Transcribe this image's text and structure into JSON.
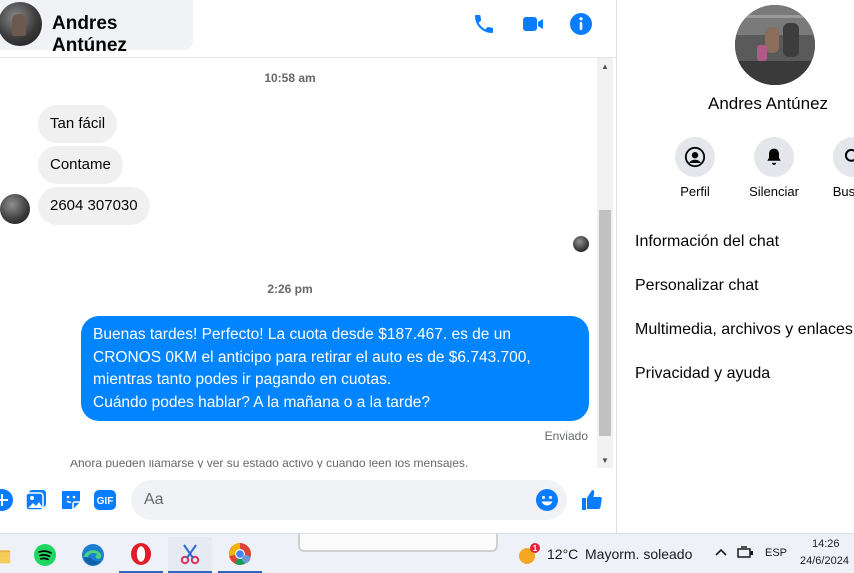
{
  "header": {
    "contact_name": "Andres Antúnez",
    "icons": [
      "phone-icon",
      "video-call-icon",
      "info-icon"
    ]
  },
  "messages": {
    "timestamp_1": "10:58 am",
    "incoming": [
      "Tan fácil",
      "Contame",
      "2604 307030"
    ],
    "timestamp_2": "2:26 pm",
    "outgoing_lines": [
      "Buenas tardes! Perfecto! La cuota desde $187.467. es de un",
      "CRONOS 0KM el anticipo para retirar el auto es de $6.743.700,",
      "mientras tanto podes ir pagando en cuotas.",
      "Cuándo podes hablar? A la mañana o a la tarde?"
    ],
    "sent_status": "Enviado",
    "notice": "Ahora pueden llamarse y ver su estado activo y cuándo leen los mensajes."
  },
  "composer": {
    "placeholder": "Aa",
    "icons": [
      "plus-icon",
      "photo-icon",
      "sticker-icon",
      "gif-icon",
      "emoji-icon",
      "like-icon"
    ],
    "gif_label": "GIF"
  },
  "side_panel": {
    "name": "Andres Antúnez",
    "actions": [
      {
        "label": "Perfil",
        "icon": "profile-icon"
      },
      {
        "label": "Silenciar",
        "icon": "bell-icon"
      },
      {
        "label": "Buscar",
        "icon": "search-icon"
      }
    ],
    "menu": [
      "Información del chat",
      "Personalizar chat",
      "Multimedia, archivos y enlaces",
      "Privacidad y ayuda"
    ]
  },
  "taskbar": {
    "apps": [
      "file-explorer-icon",
      "spotify-icon",
      "edge-icon",
      "opera-icon",
      "snipping-tool-icon",
      "chrome-icon"
    ],
    "weather_badge": "1",
    "temperature": "12°C",
    "weather": "Mayorm. soleado",
    "language": "ESP",
    "time": "14:26",
    "date": "24/6/2024"
  },
  "colors": {
    "accent": "#0084ff",
    "icon_blue": "#0a7cff",
    "incoming_bubble": "#f0f0f0",
    "taskbar": "#eef2f8"
  }
}
